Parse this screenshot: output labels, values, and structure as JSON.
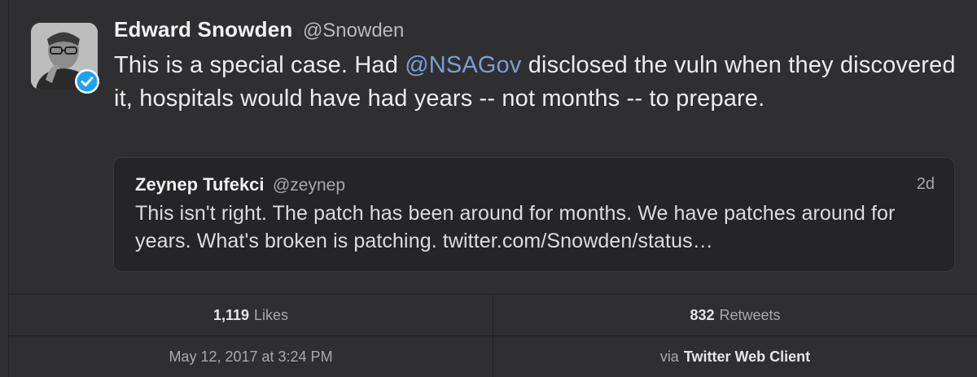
{
  "tweet": {
    "display_name": "Edward Snowden",
    "handle": "@Snowden",
    "verified": true,
    "text_before": "This is a special case. Had ",
    "mention": "@NSAGov",
    "text_after": " disclosed the vuln when they discovered it, hospitals would have had years -- not months -- to prepare."
  },
  "quoted_tweet": {
    "display_name": "Zeynep Tufekci",
    "handle": "@zeynep",
    "time_ago": "2d",
    "text": "This isn't right. The patch has been around for months. We have patches around for years. What's broken is patching. twitter.com/Snowden/status…"
  },
  "stats": {
    "likes_count": "1,119",
    "likes_label": "Likes",
    "retweets_count": "832",
    "retweets_label": "Retweets",
    "timestamp": "May 12, 2017 at 3:24 PM",
    "via_label": "via",
    "client": "Twitter Web Client"
  },
  "colors": {
    "background": "#2f2f31",
    "mention": "#7a9dd8",
    "verified": "#1da1f2"
  },
  "icons": {
    "verified": "verified-badge-icon",
    "avatar": "profile-photo"
  }
}
